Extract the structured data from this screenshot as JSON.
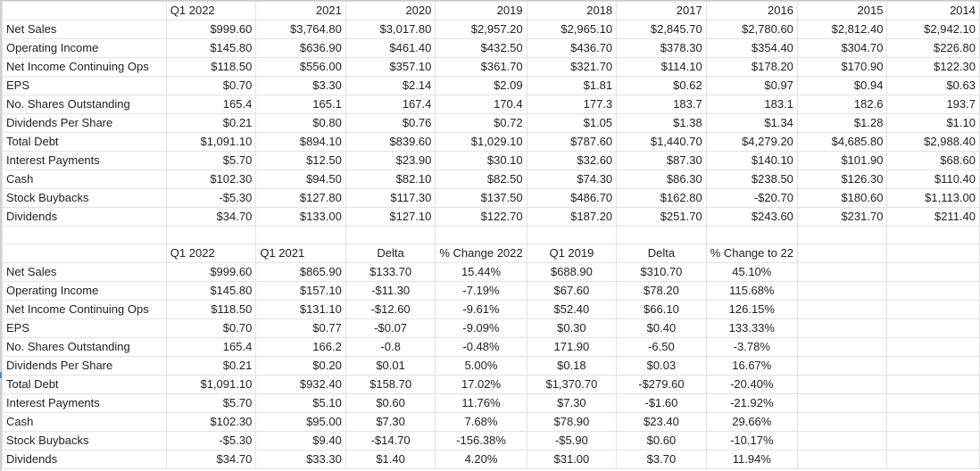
{
  "table1": {
    "headers": [
      "",
      "Q1 2022",
      "2021",
      "2020",
      "2019",
      "2018",
      "2017",
      "2016",
      "2015",
      "2014"
    ],
    "rows": [
      [
        "Net Sales",
        "$999.60",
        "$3,764.80",
        "$3,017.80",
        "$2,957.20",
        "$2,965.10",
        "$2,845.70",
        "$2,780.60",
        "$2,812.40",
        "$2,942.10"
      ],
      [
        "Operating Income",
        "$145.80",
        "$636.90",
        "$461.40",
        "$432.50",
        "$436.70",
        "$378.30",
        "$354.40",
        "$304.70",
        "$226.80"
      ],
      [
        "Net Income Continuing Ops",
        "$118.50",
        "$556.00",
        "$357.10",
        "$361.70",
        "$321.70",
        "$114.10",
        "$178.20",
        "$170.90",
        "$122.30"
      ],
      [
        "EPS",
        "$0.70",
        "$3.30",
        "$2.14",
        "$2.09",
        "$1.81",
        "$0.62",
        "$0.97",
        "$0.94",
        "$0.63"
      ],
      [
        "No. Shares Outstanding",
        "165.4",
        "165.1",
        "167.4",
        "170.4",
        "177.3",
        "183.7",
        "183.1",
        "182.6",
        "193.7"
      ],
      [
        "Dividends Per Share",
        "$0.21",
        "$0.80",
        "$0.76",
        "$0.72",
        "$1.05",
        "$1.38",
        "$1.34",
        "$1.28",
        "$1.10"
      ],
      [
        "Total Debt",
        "$1,091.10",
        "$894.10",
        "$839.60",
        "$1,029.10",
        "$787.60",
        "$1,440.70",
        "$4,279.20",
        "$4,685.80",
        "$2,988.40"
      ],
      [
        "Interest Payments",
        "$5.70",
        "$12.50",
        "$23.90",
        "$30.10",
        "$32.60",
        "$87.30",
        "$140.10",
        "$101.90",
        "$68.60"
      ],
      [
        "Cash",
        "$102.30",
        "$94.50",
        "$82.10",
        "$82.50",
        "$74.30",
        "$86.30",
        "$238.50",
        "$126.30",
        "$110.40"
      ],
      [
        "Stock Buybacks",
        "-$5.30",
        "$127.80",
        "$117.30",
        "$137.50",
        "$486.70",
        "$162.80",
        "-$20.70",
        "$180.60",
        "$1,113.00"
      ],
      [
        "Dividends",
        "$34.70",
        "$133.00",
        "$127.10",
        "$122.70",
        "$187.20",
        "$251.70",
        "$243.60",
        "$231.70",
        "$211.40"
      ]
    ]
  },
  "table2": {
    "headers": [
      "",
      "Q1 2022",
      "Q1 2021",
      "Delta",
      "% Change 2022",
      "Q1 2019",
      "Delta",
      "% Change to 22",
      "",
      ""
    ],
    "rows": [
      [
        "Net Sales",
        "$999.60",
        "$865.90",
        "$133.70",
        "15.44%",
        "$688.90",
        "$310.70",
        "45.10%",
        "",
        ""
      ],
      [
        "Operating Income",
        "$145.80",
        "$157.10",
        "-$11.30",
        "-7.19%",
        "$67.60",
        "$78.20",
        "115.68%",
        "",
        ""
      ],
      [
        "Net Income Continuing Ops",
        "$118.50",
        "$131.10",
        "-$12.60",
        "-9.61%",
        "$52.40",
        "$66.10",
        "126.15%",
        "",
        ""
      ],
      [
        "EPS",
        "$0.70",
        "$0.77",
        "-$0.07",
        "-9.09%",
        "$0.30",
        "$0.40",
        "133.33%",
        "",
        ""
      ],
      [
        "No. Shares Outstanding",
        "165.4",
        "166.2",
        "-0.8",
        "-0.48%",
        "171.90",
        "-6.50",
        "-3.78%",
        "",
        ""
      ],
      [
        "Dividends Per Share",
        "$0.21",
        "$0.20",
        "$0.01",
        "5.00%",
        "$0.18",
        "$0.03",
        "16.67%",
        "",
        ""
      ],
      [
        "Total Debt",
        "$1,091.10",
        "$932.40",
        "$158.70",
        "17.02%",
        "$1,370.70",
        "-$279.60",
        "-20.40%",
        "",
        ""
      ],
      [
        "Interest Payments",
        "$5.70",
        "$5.10",
        "$0.60",
        "11.76%",
        "$7.30",
        "-$1.60",
        "-21.92%",
        "",
        ""
      ],
      [
        "Cash",
        "$102.30",
        "$95.00",
        "$7.30",
        "7.68%",
        "$78.90",
        "$23.40",
        "29.66%",
        "",
        ""
      ],
      [
        "Stock Buybacks",
        "-$5.30",
        "$9.40",
        "-$14.70",
        "-156.38%",
        "-$5.90",
        "$0.60",
        "-10.17%",
        "",
        ""
      ],
      [
        "Dividends",
        "$34.70",
        "$33.30",
        "$1.40",
        "4.20%",
        "$31.00",
        "$3.70",
        "11.94%",
        "",
        ""
      ]
    ]
  },
  "colors": {
    "gridline": "#e2e2e2",
    "selection": "#4a86e8"
  }
}
